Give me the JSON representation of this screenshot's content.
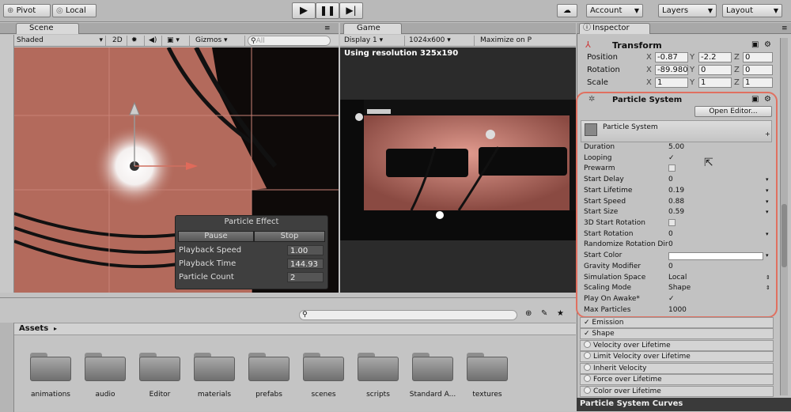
{
  "toolbar": {
    "pivot": "Pivot",
    "local": "Local",
    "account": "Account",
    "layers": "Layers",
    "layout": "Layout"
  },
  "scene": {
    "tab": "Scene",
    "shading": "Shaded",
    "mode2d": "2D",
    "gizmos": "Gizmos",
    "search_placeholder": "All"
  },
  "game": {
    "tab": "Game",
    "display": "Display 1",
    "resolution": "1024x600",
    "maximize": "Maximize on P",
    "overlay": "Using resolution 325x190"
  },
  "particle_effect": {
    "title": "Particle Effect",
    "pause": "Pause",
    "stop": "Stop",
    "rows": [
      {
        "label": "Playback Speed",
        "value": "1.00"
      },
      {
        "label": "Playback Time",
        "value": "144.93"
      },
      {
        "label": "Particle Count",
        "value": "2"
      }
    ]
  },
  "inspector": {
    "tab": "Inspector",
    "transform": {
      "title": "Transform",
      "position": {
        "label": "Position",
        "x": "-0.87",
        "y": "-2.2",
        "z": "0"
      },
      "rotation": {
        "label": "Rotation",
        "x": "-89.980",
        "y": "0",
        "z": "0"
      },
      "scale": {
        "label": "Scale",
        "x": "1",
        "y": "1",
        "z": "1"
      }
    },
    "particle_system": {
      "title": "Particle System",
      "open_editor": "Open Editor...",
      "main_header": "Particle System",
      "props": [
        {
          "label": "Duration",
          "value": "5.00"
        },
        {
          "label": "Looping",
          "value": "✓"
        },
        {
          "label": "Prewarm",
          "value": ""
        },
        {
          "label": "Start Delay",
          "value": "0"
        },
        {
          "label": "Start Lifetime",
          "value": "0.19"
        },
        {
          "label": "Start Speed",
          "value": "0.88"
        },
        {
          "label": "Start Size",
          "value": "0.59"
        },
        {
          "label": "3D Start Rotation",
          "value": ""
        },
        {
          "label": "Start Rotation",
          "value": "0"
        },
        {
          "label": "Randomize Rotation Dir",
          "value": "0"
        },
        {
          "label": "Start Color",
          "value": ""
        },
        {
          "label": "Gravity Modifier",
          "value": "0"
        },
        {
          "label": "Simulation Space",
          "value": "Local"
        },
        {
          "label": "Scaling Mode",
          "value": "Shape"
        },
        {
          "label": "Play On Awake*",
          "value": "✓"
        },
        {
          "label": "Max Particles",
          "value": "1000"
        }
      ],
      "modules": [
        {
          "label": "Emission",
          "checked": "✓"
        },
        {
          "label": "Shape",
          "checked": "✓"
        },
        {
          "label": "Velocity over Lifetime",
          "checked": ""
        },
        {
          "label": "Limit Velocity over Lifetime",
          "checked": ""
        },
        {
          "label": "Inherit Velocity",
          "checked": ""
        },
        {
          "label": "Force over Lifetime",
          "checked": ""
        },
        {
          "label": "Color over Lifetime",
          "checked": ""
        }
      ],
      "curves": "Particle System Curves"
    }
  },
  "project": {
    "breadcrumb": "Assets",
    "folders": [
      "animations",
      "audio",
      "Editor",
      "materials",
      "prefabs",
      "scenes",
      "scripts",
      "Standard A...",
      "textures"
    ]
  },
  "colors": {
    "highlight": "#e07060",
    "scene_bg": "#b86b5e"
  }
}
